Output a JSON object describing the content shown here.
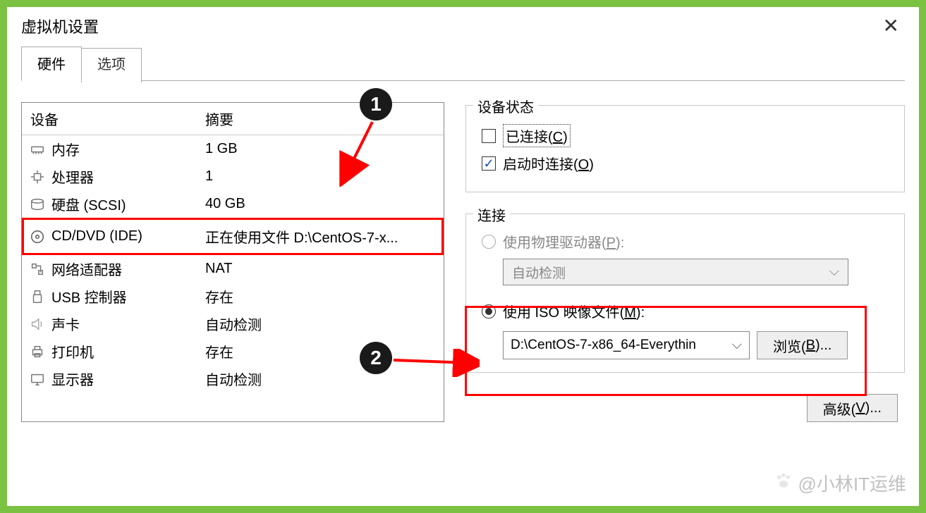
{
  "title_bar": {
    "title": "虚拟机设置"
  },
  "tabs": {
    "hardware": "硬件",
    "options": "选项"
  },
  "device_table": {
    "header_device": "设备",
    "header_summary": "摘要",
    "rows": [
      {
        "icon": "memory-icon",
        "name": "内存",
        "summary": "1 GB"
      },
      {
        "icon": "cpu-icon",
        "name": "处理器",
        "summary": "1"
      },
      {
        "icon": "disk-icon",
        "name": "硬盘 (SCSI)",
        "summary": "40 GB"
      },
      {
        "icon": "cd-icon",
        "name": "CD/DVD (IDE)",
        "summary": "正在使用文件 D:\\CentOS-7-x...",
        "highlight": true
      },
      {
        "icon": "network-icon",
        "name": "网络适配器",
        "summary": "NAT"
      },
      {
        "icon": "usb-icon",
        "name": "USB 控制器",
        "summary": "存在"
      },
      {
        "icon": "sound-icon",
        "name": "声卡",
        "summary": "自动检测"
      },
      {
        "icon": "printer-icon",
        "name": "打印机",
        "summary": "存在"
      },
      {
        "icon": "display-icon",
        "name": "显示器",
        "summary": "自动检测"
      }
    ]
  },
  "device_status": {
    "legend": "设备状态",
    "connected": "已连接(",
    "connected_key": "C",
    "connect_at_power": "启动时连接(",
    "connect_at_power_key": "O",
    "close_paren": ")"
  },
  "connection": {
    "legend": "连接",
    "physical_label": "使用物理驱动器(",
    "physical_key": "P",
    "physical_combo": "自动检测",
    "iso_label": "使用 ISO 映像文件(",
    "iso_key": "M",
    "iso_value": "D:\\CentOS-7-x86_64-Everythin",
    "browse": "浏览(",
    "browse_key": "B",
    "browse_suffix": ")..."
  },
  "advanced": {
    "label": "高级(",
    "key": "V",
    "suffix": ")..."
  },
  "callouts": {
    "one": "1",
    "two": "2"
  },
  "watermark": "@小林IT运维"
}
